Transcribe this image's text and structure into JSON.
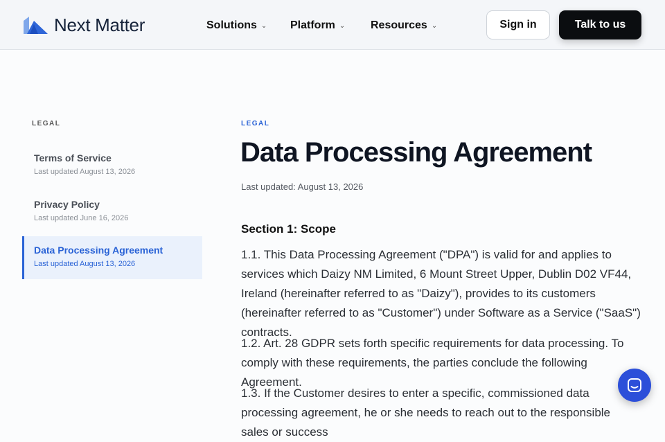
{
  "header": {
    "brand": "Next Matter",
    "nav": [
      {
        "label": "Solutions"
      },
      {
        "label": "Platform"
      },
      {
        "label": "Resources"
      }
    ],
    "sign_in": "Sign in",
    "cta": "Talk to us"
  },
  "sidebar": {
    "label": "LEGAL",
    "items": [
      {
        "title": "Terms of Service",
        "date": "Last updated August 13, 2026"
      },
      {
        "title": "Privacy Policy",
        "date": "Last updated June 16, 2026"
      },
      {
        "title": "Data Processing Agreement",
        "date": "Last updated August 13, 2026"
      }
    ]
  },
  "main": {
    "eyebrow": "LEGAL",
    "title": "Data Processing Agreement",
    "updated": "Last updated: August 13, 2026",
    "section_title": "Section 1: Scope",
    "paragraphs": [
      "1.1. This Data Processing Agreement (\"DPA\") is valid for and applies to services which Daizy NM Limited, 6 Mount Street Upper, Dublin D02 VF44, Ireland (hereinafter referred to as \"Daizy\"), provides to its customers (hereinafter referred to as \"Customer\") under Software as a Service (\"SaaS\") contracts.",
      "1.2. Art. 28 GDPR sets forth specific requirements for data processing. To comply with these requirements, the parties conclude the following Agreement.",
      "1.3. If the Customer desires to enter a specific, commissioned data processing agreement, he or she needs to reach out to the responsible sales or success"
    ]
  },
  "colors": {
    "accent": "#2a63d6",
    "cta_bg": "#0b0d10",
    "chat_bg": "#2c4fd9"
  }
}
